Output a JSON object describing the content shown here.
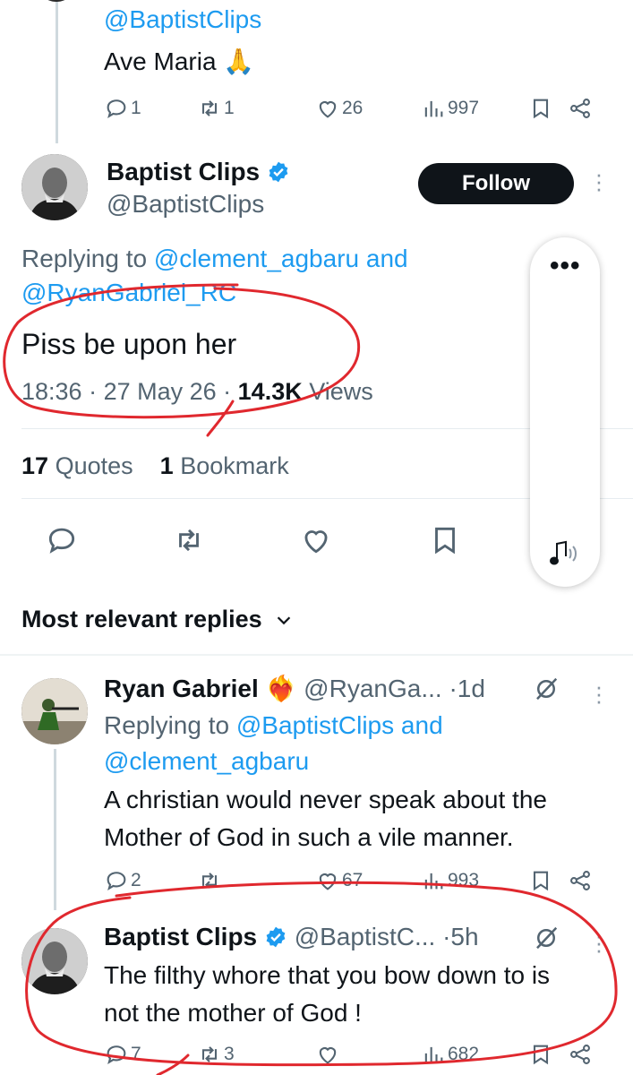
{
  "prev_tweet": {
    "handle": "@BaptistClips",
    "text": "Ave Maria 🙏",
    "replies": "1",
    "retweets": "1",
    "likes": "26",
    "views": "997"
  },
  "main_tweet": {
    "display_name": "Baptist Clips",
    "handle": "@BaptistClips",
    "follow_label": "Follow",
    "replying_prefix": "Replying to",
    "replying_user1": "@clement_agbaru",
    "replying_and": "and",
    "replying_user2": "@RyanGabriel_RC",
    "text": "Piss be upon her",
    "time": "18:36",
    "date": "27 May 26",
    "views_count": "14.3K",
    "views_label": "Views",
    "quotes_count": "17",
    "quotes_label": "Quotes",
    "bookmarks_count": "1",
    "bookmarks_label": "Bookmark"
  },
  "replies_header": "Most relevant replies",
  "reply1": {
    "display_name": "Ryan Gabriel",
    "emoji": "❤️‍🔥",
    "handle": "@RyanGa...",
    "time": "1d",
    "replying_prefix": "Replying to",
    "replying_user1": "@BaptistClips",
    "replying_and": "and",
    "replying_user2": "@clement_agbaru",
    "text_line1": "A christian would never speak about the",
    "text_line2": "Mother of God in such a vile manner.",
    "replies": "2",
    "likes": "67",
    "views": "993"
  },
  "reply2": {
    "display_name": "Baptist Clips",
    "handle": "@BaptistC...",
    "time": "5h",
    "text_line1": "The filthy whore that you bow down to is",
    "text_line2": "not the mother of God !",
    "replies": "7",
    "retweets": "3",
    "views": "682"
  },
  "colors": {
    "accent": "#1d9bf0",
    "text": "#0f1419",
    "secondary": "#536471",
    "annotation": "#e0282e"
  }
}
